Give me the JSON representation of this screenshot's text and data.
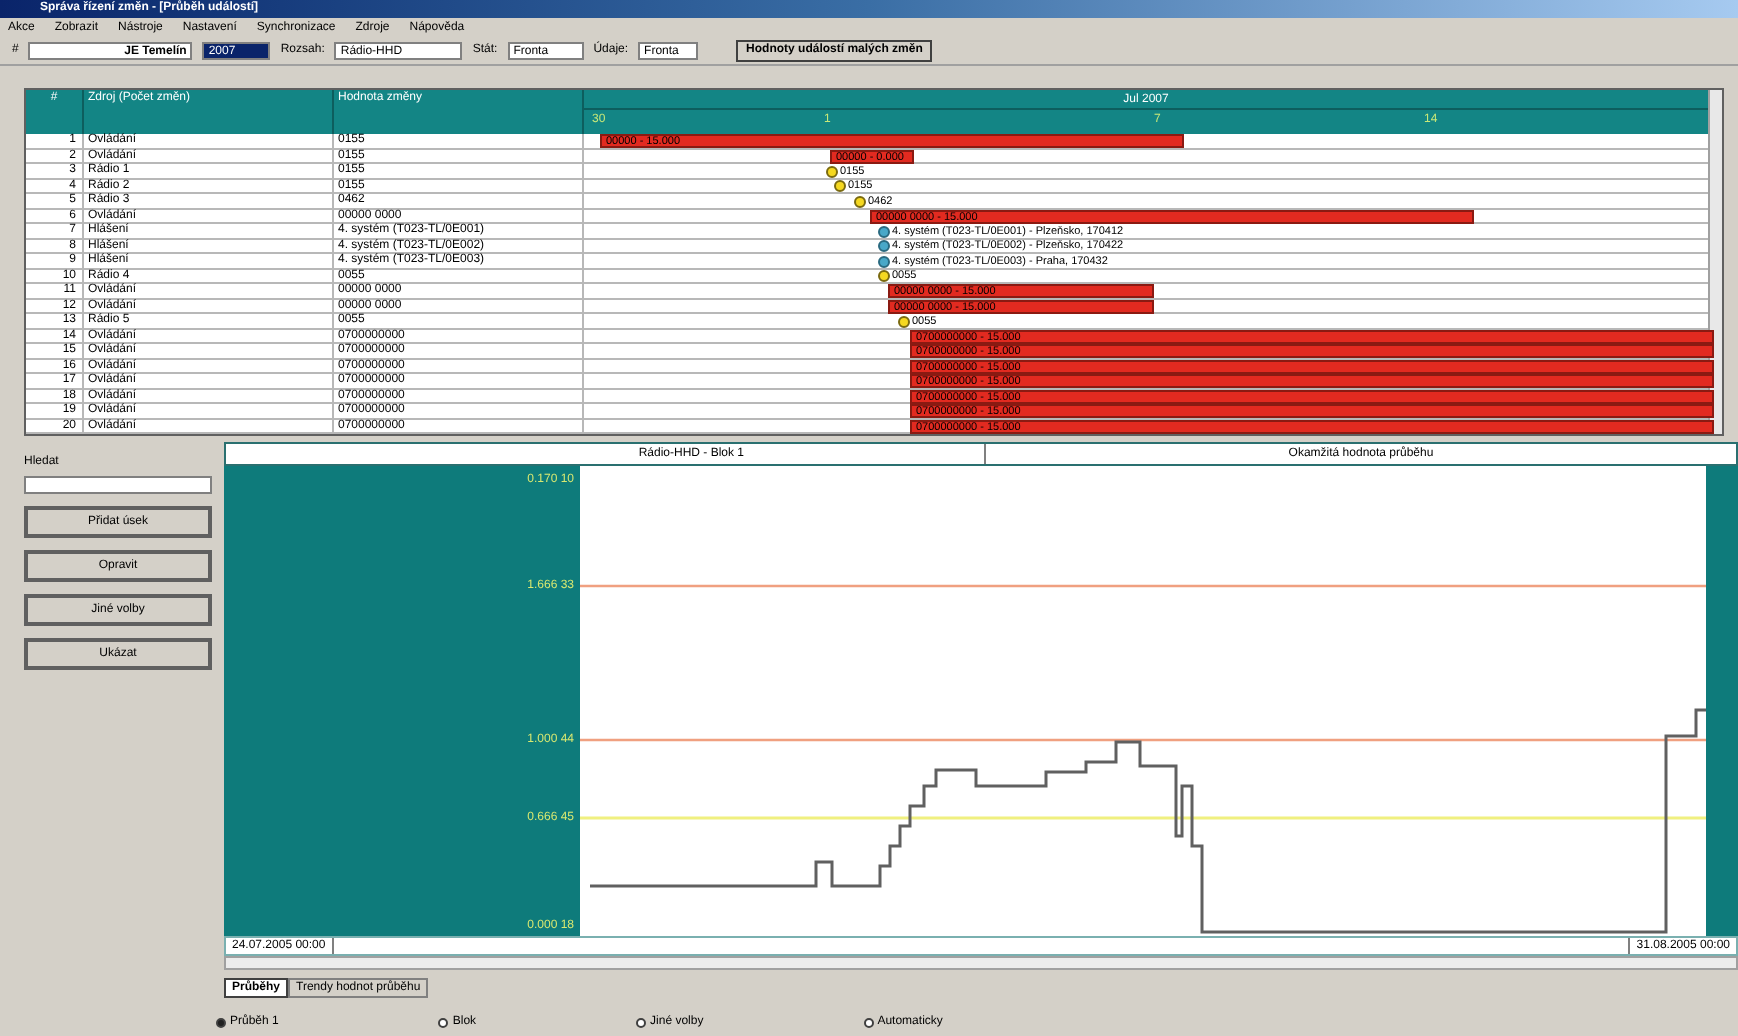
{
  "window": {
    "title": "Správa řízení změn - [Průběh událostí]"
  },
  "menu": [
    "Akce",
    "Zobrazit",
    "Nástroje",
    "Nastavení",
    "Synchronizace",
    "Zdroje",
    "Nápověda"
  ],
  "toolbar": {
    "label_id": "#",
    "station": "JE Temelín",
    "year": "2007",
    "range_label": "Rozsah:",
    "range": "Rádio-HHD",
    "state_label": "Stát:",
    "state": "Fronta",
    "data_label": "Údaje:",
    "data": "Fronta",
    "action": "Hodnoty událostí malých změn"
  },
  "grid": {
    "columns": [
      "#",
      "Zdroj (Počet změn)",
      "Hodnota změny"
    ],
    "month": "Jul 2007",
    "days": [
      "30",
      "1",
      "7",
      "14"
    ],
    "rows": [
      {
        "n": "1",
        "name": "Ovládání",
        "value": "0155",
        "kind": "bar",
        "label": "00000 - 15.000"
      },
      {
        "n": "2",
        "name": "Ovládání",
        "value": "0155",
        "kind": "bar",
        "label": "00000 - 0.000"
      },
      {
        "n": "3",
        "name": "Rádio 1",
        "value": "0155",
        "kind": "milestone",
        "label": "0155"
      },
      {
        "n": "4",
        "name": "Rádio 2",
        "value": "0155",
        "kind": "milestone",
        "label": "0155"
      },
      {
        "n": "5",
        "name": "Rádio 3",
        "value": "0462",
        "kind": "milestone",
        "label": "0462"
      },
      {
        "n": "6",
        "name": "Ovládání",
        "value": "00000 0000",
        "kind": "bar",
        "label": "00000 0000 - 15.000"
      },
      {
        "n": "7",
        "name": "Hlášení",
        "value": "4. systém (T023-TL/0E001)",
        "kind": "info",
        "label": "4. systém (T023-TL/0E001) - Plzeňsko, 170412"
      },
      {
        "n": "8",
        "name": "Hlášení",
        "value": "4. systém (T023-TL/0E002)",
        "kind": "info",
        "label": "4. systém (T023-TL/0E002) - Plzeňsko, 170422"
      },
      {
        "n": "9",
        "name": "Hlášení",
        "value": "4. systém (T023-TL/0E003)",
        "kind": "info",
        "label": "4. systém (T023-TL/0E003) - Praha, 170432"
      },
      {
        "n": "10",
        "name": "Rádio 4",
        "value": "0055",
        "kind": "milestone",
        "label": "0055"
      },
      {
        "n": "11",
        "name": "Ovládání",
        "value": "00000 0000",
        "kind": "bar",
        "label": "00000 0000 - 15.000"
      },
      {
        "n": "12",
        "name": "Ovládání",
        "value": "00000 0000",
        "kind": "bar",
        "label": "00000 0000 - 15.000"
      },
      {
        "n": "13",
        "name": "Rádio 5",
        "value": "0055",
        "kind": "milestone",
        "label": "0055"
      },
      {
        "n": "14",
        "name": "Ovládání",
        "value": "0700000000",
        "kind": "bar",
        "label": "0700000000 - 15.000"
      },
      {
        "n": "15",
        "name": "Ovládání",
        "value": "0700000000",
        "kind": "bar",
        "label": "0700000000 - 15.000"
      },
      {
        "n": "16",
        "name": "Ovládání",
        "value": "0700000000",
        "kind": "bar",
        "label": "0700000000 - 15.000"
      },
      {
        "n": "17",
        "name": "Ovládání",
        "value": "0700000000",
        "kind": "bar",
        "label": "0700000000 - 15.000"
      },
      {
        "n": "18",
        "name": "Ovládání",
        "value": "0700000000",
        "kind": "bar",
        "label": "0700000000 - 15.000"
      },
      {
        "n": "19",
        "name": "Ovládání",
        "value": "0700000000",
        "kind": "bar",
        "label": "0700000000 - 15.000"
      },
      {
        "n": "20",
        "name": "Ovládání",
        "value": "0700000000",
        "kind": "bar",
        "label": "0700000000 - 15.000"
      }
    ]
  },
  "side": {
    "search_label": "Hledat",
    "buttons": [
      "Přidat úsek",
      "Opravit",
      "Jiné volby",
      "Ukázat"
    ]
  },
  "chart": {
    "headers": [
      "Rádio-HHD - Blok 1",
      "Okamžitá hodnota průběhu"
    ],
    "y_labels": [
      "0.170 10",
      "1.666 33",
      "1.000 44",
      "0.666 45",
      "0.000 18"
    ],
    "start_time": "24.07.2005 00:00",
    "end_time": "31.08.2005 00:00"
  },
  "tabs": [
    {
      "label": "Průběhy",
      "selected": true
    },
    {
      "label": "Trendy hodnot průběhu",
      "selected": false
    }
  ],
  "options": [
    {
      "label": "Průběh 1",
      "selected": true
    },
    {
      "label": "Blok",
      "selected": false
    },
    {
      "label": "Jiné volby",
      "selected": false
    },
    {
      "label": "Automaticky",
      "selected": false
    }
  ]
}
